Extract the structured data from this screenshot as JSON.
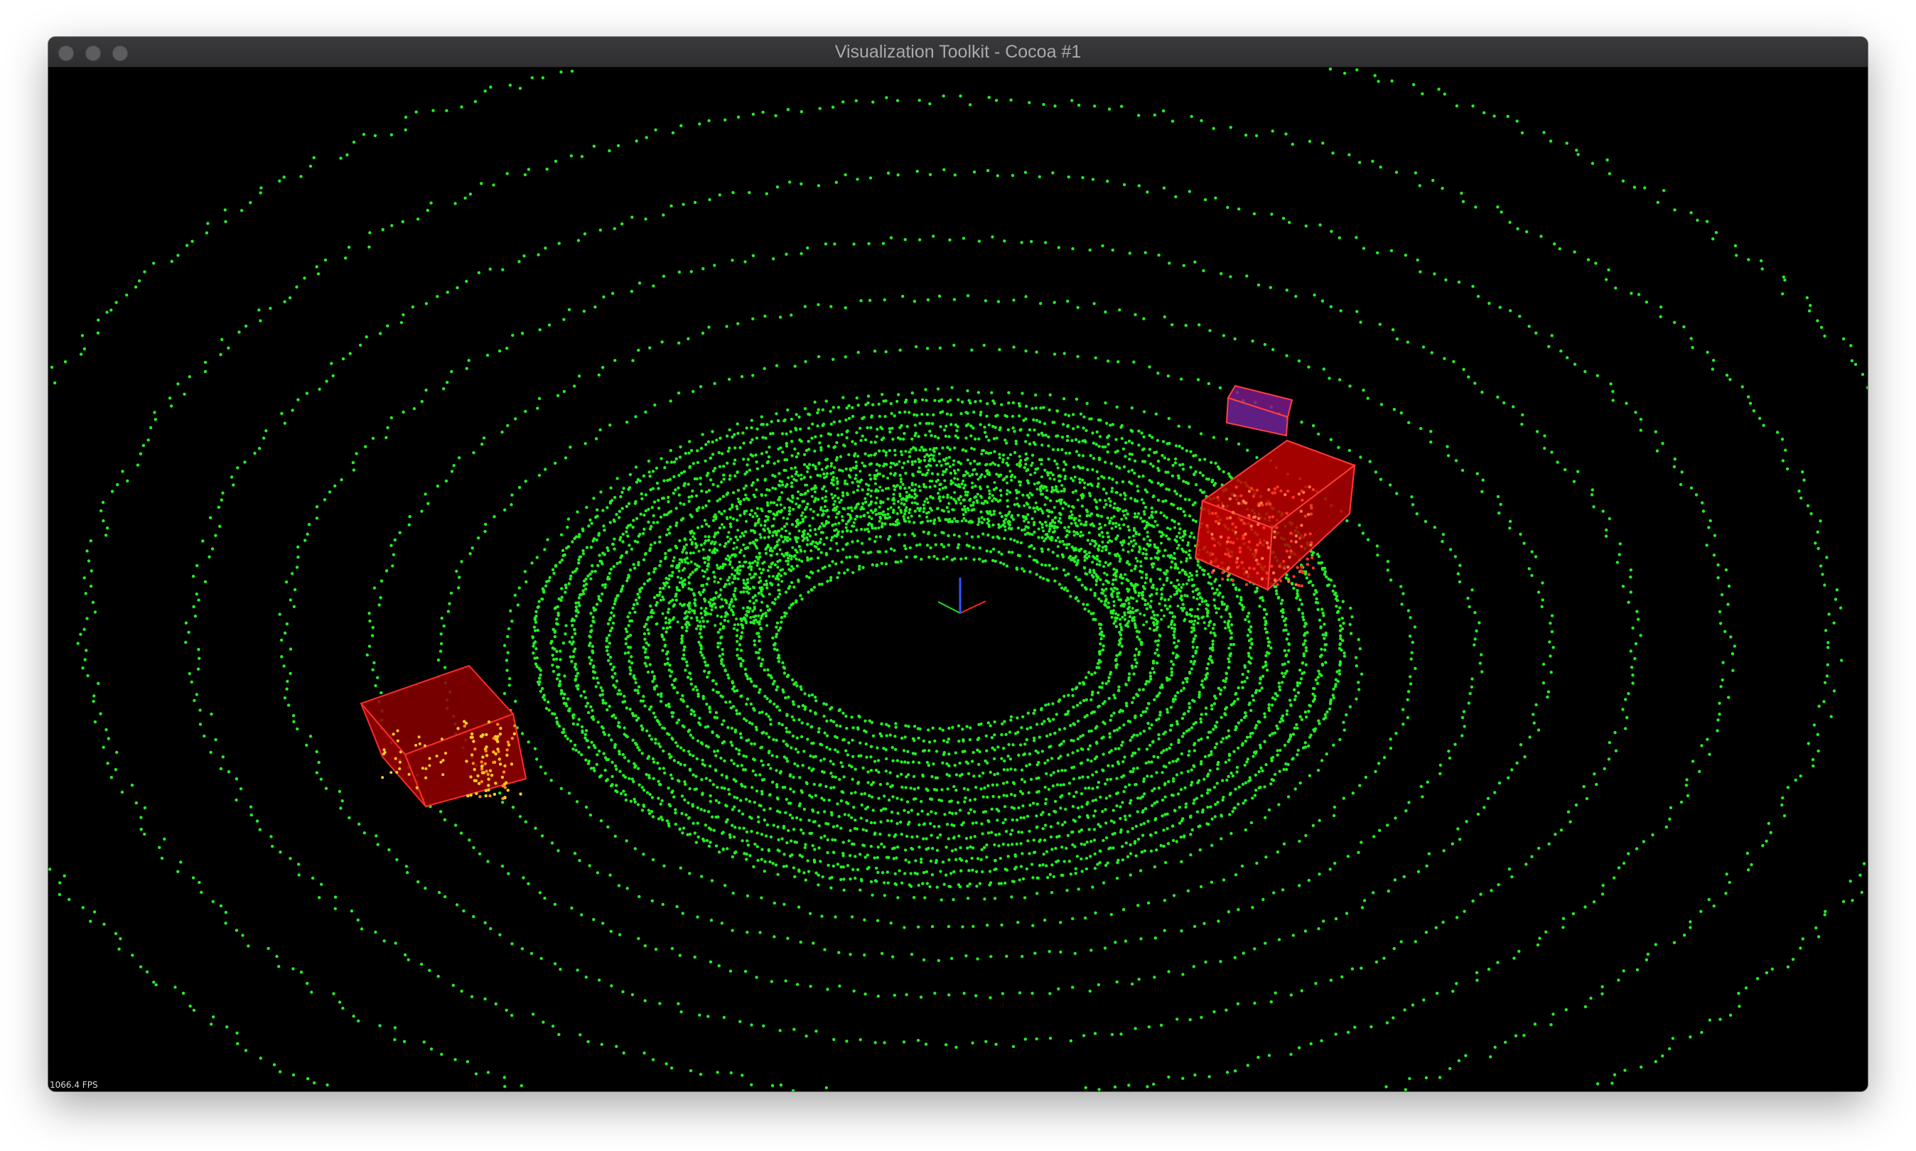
{
  "window": {
    "title": "Visualization Toolkit - Cocoa #1"
  },
  "viewport": {
    "fps_label": "1066.4 FPS"
  },
  "colors": {
    "background": "#000000",
    "point_cloud": "#22ee22",
    "bounding_box_fill": "#aa0000",
    "bounding_box_edge": "#ff2a2a",
    "highlighted_points": "#ffcc22",
    "small_box_fill": "#7a1a8a",
    "axis_x": "#ff2222",
    "axis_y": "#22dd22",
    "axis_z": "#3355ff"
  },
  "icons": [
    "close-button",
    "minimize-button",
    "zoom-button"
  ]
}
